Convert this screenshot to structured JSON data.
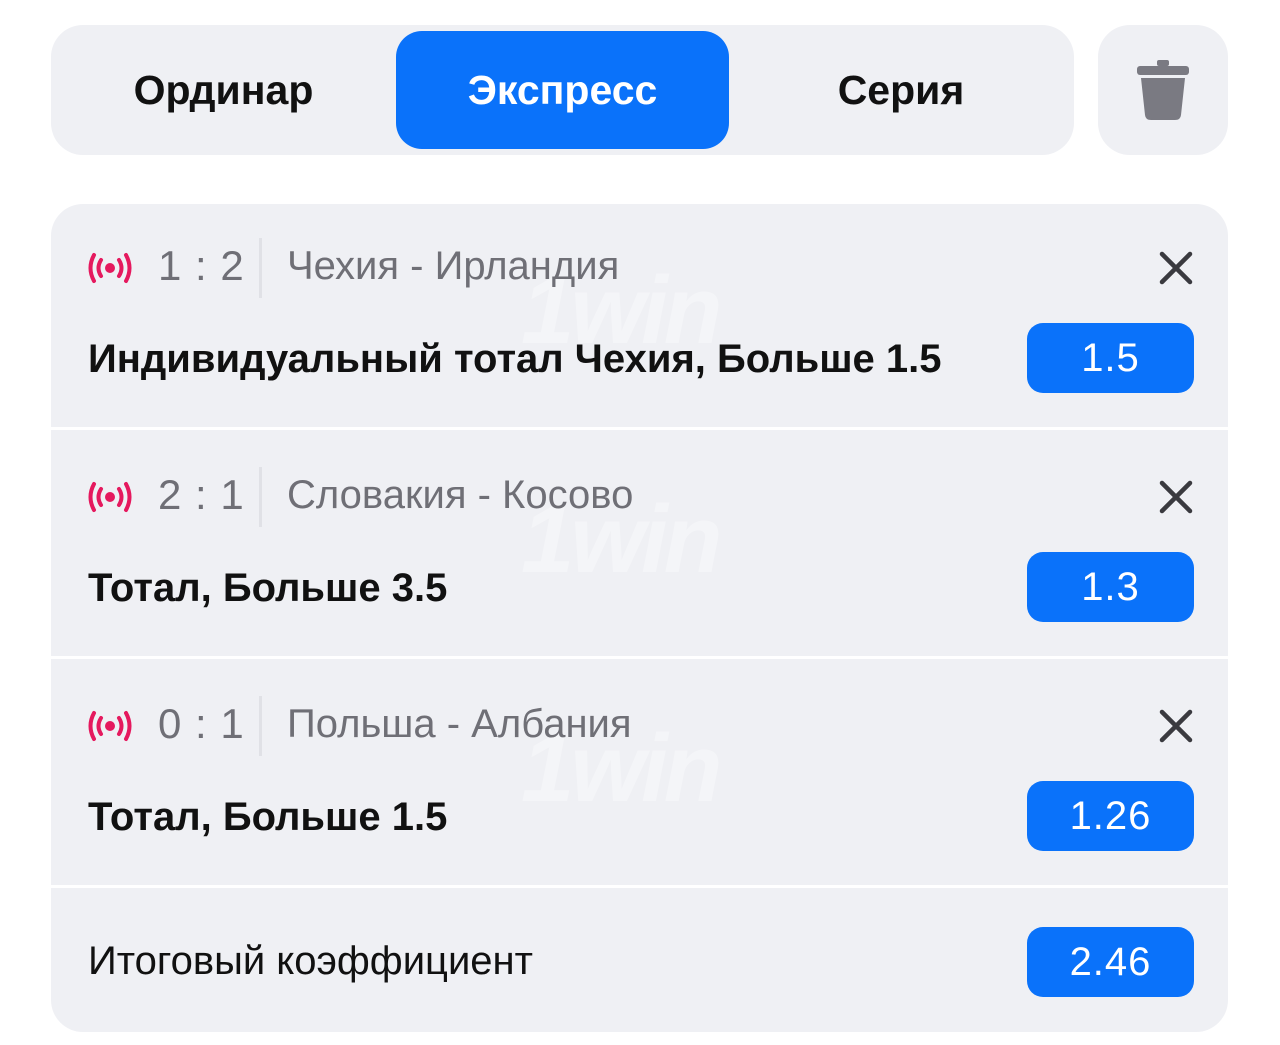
{
  "tabs": [
    {
      "label": "Ординар",
      "active": false
    },
    {
      "label": "Экспресс",
      "active": true
    },
    {
      "label": "Серия",
      "active": false
    }
  ],
  "trash_icon": "trash-icon",
  "bets": [
    {
      "score": "1 : 2",
      "match": "Чехия - Ирландия",
      "selection": "Индивидуальный тотал Чехия, Больше 1.5",
      "odds": "1.5"
    },
    {
      "score": "2 : 1",
      "match": "Словакия - Косово",
      "selection": "Тотал, Больше 3.5",
      "odds": "1.3"
    },
    {
      "score": "0 : 1",
      "match": "Польша - Албания",
      "selection": "Тотал, Больше 1.5",
      "odds": "1.26"
    }
  ],
  "total": {
    "label": "Итоговый коэффициент",
    "odds": "2.46"
  },
  "watermark": "1win",
  "colors": {
    "accent": "#0a72fa",
    "live": "#e5195e",
    "panel": "#eff0f4",
    "muted": "#6f6f76"
  }
}
